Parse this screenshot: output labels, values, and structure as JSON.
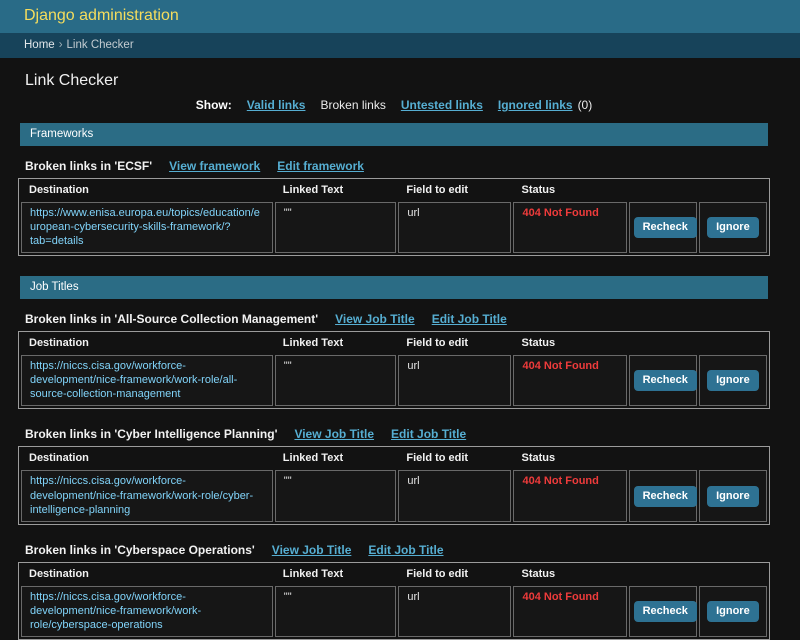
{
  "header": {
    "brand": "Django administration"
  },
  "breadcrumbs": {
    "home": "Home",
    "separator": "›",
    "current": "Link Checker"
  },
  "page": {
    "title": "Link Checker"
  },
  "filter": {
    "label": "Show:",
    "valid_label": "Valid links",
    "broken_label": "Broken links",
    "untested_label": "Untested links",
    "ignored_label": "Ignored links",
    "ignored_count": "(0)"
  },
  "columns": [
    "Destination",
    "Linked Text",
    "Field to edit",
    "Status"
  ],
  "buttons": {
    "recheck": "Recheck",
    "ignore": "Ignore"
  },
  "sections": [
    {
      "caption": "Frameworks",
      "groups": [
        {
          "heading": "Broken links in 'ECSF'",
          "view_label": "View framework",
          "edit_label": "Edit framework",
          "rows": [
            {
              "destination": "https://www.enisa.europa.eu/topics/education/european-cybersecurity-skills-framework/?tab=details",
              "linked_text": "\"\"",
              "field": "url",
              "status": "404 Not Found"
            }
          ]
        }
      ]
    },
    {
      "caption": "Job Titles",
      "groups": [
        {
          "heading": "Broken links in 'All-Source Collection Management'",
          "view_label": "View Job Title",
          "edit_label": "Edit Job Title",
          "rows": [
            {
              "destination": "https://niccs.cisa.gov/workforce-development/nice-framework/work-role/all-source-collection-management",
              "linked_text": "\"\"",
              "field": "url",
              "status": "404 Not Found"
            }
          ]
        },
        {
          "heading": "Broken links in 'Cyber Intelligence Planning'",
          "view_label": "View Job Title",
          "edit_label": "Edit Job Title",
          "rows": [
            {
              "destination": "https://niccs.cisa.gov/workforce-development/nice-framework/work-role/cyber-intelligence-planning",
              "linked_text": "\"\"",
              "field": "url",
              "status": "404 Not Found"
            }
          ]
        },
        {
          "heading": "Broken links in 'Cyberspace Operations'",
          "view_label": "View Job Title",
          "edit_label": "Edit Job Title",
          "rows": [
            {
              "destination": "https://niccs.cisa.gov/workforce-development/nice-framework/work-role/cyberspace-operations",
              "linked_text": "\"\"",
              "field": "url",
              "status": "404 Not Found"
            }
          ]
        }
      ]
    }
  ],
  "colors": {
    "page_bg": "#121212",
    "header_bg": "#296b87",
    "breadcrumb_bg": "#17435a",
    "brand_text": "#f5dd5d",
    "section_caption_bg": "#2b6c85",
    "url_link": "#81d4fa",
    "action_link": "#56aed2",
    "error_status": "#ee3b3b",
    "button_bg": "#2e7293"
  }
}
